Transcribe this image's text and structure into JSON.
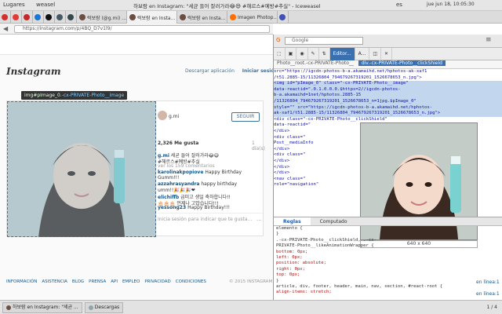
{
  "topbar": {
    "places": "Lugares",
    "app": "weasel",
    "window_title": "하보람 en Instagram: \"세균 들어 잘러가라😂😅 #해르스#예방#추실\" - Iceweasel",
    "lang": "es",
    "clock": "jue jun 18, 10:05:30"
  },
  "tabs": [
    {
      "label": "",
      "color": "#d32f2f",
      "pinned": true
    },
    {
      "label": "",
      "color": "#e53935",
      "pinned": true
    },
    {
      "label": "",
      "color": "#c62828",
      "pinned": true
    },
    {
      "label": "",
      "color": "#1976d2",
      "pinned": true
    },
    {
      "label": "",
      "color": "#111111",
      "pinned": true
    },
    {
      "label": "",
      "color": "#455a64",
      "pinned": true
    },
    {
      "label": "",
      "color": "#37474f",
      "pinned": true
    },
    {
      "label": "럭보람 (@g.mi) ...",
      "color": "#6d4c41",
      "pinned": false
    },
    {
      "label": "럭보람 en Insta...",
      "color": "#6d4c41",
      "pinned": false
    },
    {
      "label": "럭보람 en Insta...",
      "color": "#6d4c41",
      "pinned": false
    },
    {
      "label": "Imagen Photop...",
      "color": "#ff6f00",
      "pinned": false
    },
    {
      "label": "",
      "color": "#3f51b5",
      "pinned": true
    }
  ],
  "url": "https://instagram.com/p/4BQ_D7v1l9/",
  "search_placeholder": "Google",
  "instagram": {
    "logo": "Instagram",
    "download": "Descargar aplicación",
    "login": "Iniciar sesión",
    "username": "g.mi",
    "follow": "SEGUIR",
    "likes": "2,326 Me gusta",
    "ago": "1 día(s)",
    "comments": [
      {
        "user": "g.mi",
        "text": " 세균 들어 잘러가라😂😅"
      },
      {
        "user": "",
        "text": "#해르스#예방#추실"
      },
      {
        "user": "",
        "text": "ver los 159 comentarios",
        "gray": true
      },
      {
        "user": "karolinakpopiove",
        "text": " Happy Birthday"
      },
      {
        "user": "",
        "text": "Gumm!!!"
      },
      {
        "user": "azzahrasyandra",
        "text": " happy birthday"
      },
      {
        "user": "",
        "text": "umm!!🎉🎉🎉❤"
      },
      {
        "user": "elichiffb",
        "text": " 급미고 생일 축하합니다!!"
      },
      {
        "user": "",
        "text": "🎂🎂🎂 언제나 고맙습니다!!!"
      },
      {
        "user": "yessong23",
        "text": " Happy Birthday!!!"
      }
    ],
    "comment_placeholder": "Inicia sesión para indicar que te gusta...",
    "more": "...",
    "footer": [
      "INFORMACIÓN",
      "ASISTENCIA",
      "BLOG",
      "PRENSA",
      "API",
      "EMPLEO",
      "PRIVACIDAD",
      "CONDICIONES"
    ],
    "copyright": "© 2015 INSTAGRAM"
  },
  "tooltip": {
    "tag": "img#pImage_0",
    "cls": ".-cx-PRIVATE-Photo__image"
  },
  "devtools": {
    "tabs": [
      "Editor...",
      "A..."
    ],
    "crumbs": [
      "Photo__root.-cx-PRIVATE-Photo__",
      "div.-cx-PRIVATE-Photo__clickShield"
    ],
    "code": [
      {
        "text": "src=\"https://igcdn-photos-b-a.akamaihd.net/hphotos-ak-xaf1",
        "cls": ""
      },
      {
        "text": "/t51.2885-15/11326804_794679267319201_1526678653_n.jpg\">",
        "cls": ""
      },
      {
        "text": "  <img id=\"pImage_0\" class=\"-cx-PRIVATE-Photo__image\"",
        "cls": "hl"
      },
      {
        "text": "  data-reactid=\".0.1.0.0.0.$https=2//igcdn-photos-",
        "cls": "hl"
      },
      {
        "text": "  b-a.akamaihd=1net/hphotos.2885-15",
        "cls": "hl"
      },
      {
        "text": "  /11326804_794679267319201_1526678653_n=1jpg.$pImage_0\"",
        "cls": "hl"
      },
      {
        "text": "  style=\"\" src=\"https://igcdn-photos-b-a.akamaihd.net/hphotos-",
        "cls": "hl"
      },
      {
        "text": "  ak-xaf1/t51.2885-15/11326804_794679267319201_1526678653_n.jpg\">",
        "cls": "hl"
      },
      {
        "text": "  <div class=\"-cx-PRIVATE-Photo__clickShield\"",
        "cls": ""
      },
      {
        "text": "  data-reactid=\"",
        "cls": ""
      },
      {
        "text": "  </div>",
        "cls": ""
      },
      {
        "text": "  <div class=\"",
        "cls": ""
      },
      {
        "text": "  Post__mediaInfo",
        "cls": ""
      },
      {
        "text": "  </div>",
        "cls": ""
      },
      {
        "text": "  <div class=\"",
        "cls": ""
      },
      {
        "text": "  </div>",
        "cls": ""
      },
      {
        "text": "  </div>",
        "cls": ""
      },
      {
        "text": " </div>",
        "cls": ""
      },
      {
        "text": " <nav class=\"",
        "cls": ""
      },
      {
        "text": " role=\"navigation\"",
        "cls": ""
      }
    ],
    "preview_size": "640 x 640",
    "style_tabs": [
      "Reglas",
      "Computado"
    ],
    "styles": [
      {
        "kind": "sel",
        "text": "elemento {"
      },
      {
        "kind": "sel",
        "text": "}"
      },
      {
        "kind": "sel",
        "text": ".-cx-PRIVATE-Photo__clickShield, .-cx-"
      },
      {
        "kind": "sel",
        "text": "PRIVATE-Photo__likeAnimationWrapper {"
      },
      {
        "kind": "prop",
        "text": "  bottom: 0px;"
      },
      {
        "kind": "prop",
        "text": "  left: 0px;"
      },
      {
        "kind": "prop",
        "text": "  position: absolute;"
      },
      {
        "kind": "prop",
        "text": "  right: 0px;"
      },
      {
        "kind": "prop",
        "text": "  top: 0px;"
      },
      {
        "kind": "sel",
        "text": "}"
      },
      {
        "kind": "sel",
        "text": "article, div, footer, header, main, nav, section, #react-root {"
      },
      {
        "kind": "prop",
        "text": "  align-items: stretch;"
      }
    ],
    "style_links": [
      "en línea:1",
      "en línea:1"
    ]
  },
  "taskbar": {
    "items": [
      "하보람 en Instagram: \"세균 ...",
      "Descargas"
    ],
    "pager": "1 / 4"
  }
}
